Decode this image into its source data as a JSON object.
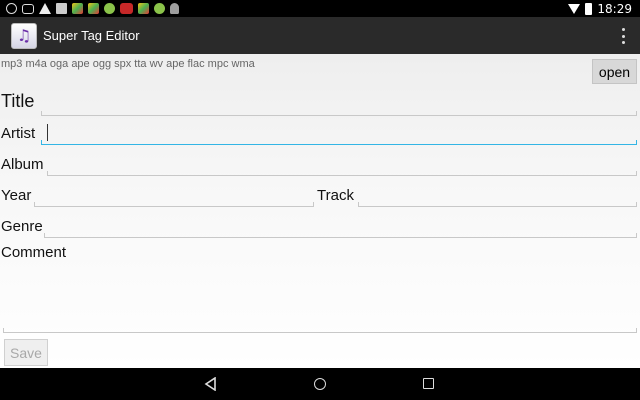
{
  "status_bar": {
    "time": "18:29",
    "icons": [
      "circle-icon",
      "cloud-icon",
      "warning-icon",
      "image-icon",
      "app-icon",
      "app-icon",
      "app-icon",
      "game-icon",
      "app-icon",
      "app-icon",
      "android-icon"
    ],
    "right_icons": [
      "wifi-icon",
      "battery-icon"
    ]
  },
  "action_bar": {
    "app_icon": "music-note-icon",
    "title": "Super Tag Editor",
    "menu_icon": "overflow-menu-icon"
  },
  "formats_text": "mp3 m4a oga ape ogg spx tta wv ape flac mpc wma",
  "open_button": "open",
  "fields": {
    "title": {
      "label": "Title",
      "value": ""
    },
    "artist": {
      "label": "Artist",
      "value": "",
      "focused": true
    },
    "album": {
      "label": "Album",
      "value": ""
    },
    "year": {
      "label": "Year",
      "value": ""
    },
    "track": {
      "label": "Track",
      "value": ""
    },
    "genre": {
      "label": "Genre",
      "value": ""
    },
    "comment": {
      "label": "Comment",
      "value": ""
    }
  },
  "save_button": {
    "label": "Save",
    "enabled": false
  },
  "nav_bar": [
    "back-icon",
    "home-icon",
    "recents-icon"
  ],
  "colors": {
    "status_bar": "#000000",
    "action_bar": "#2a2a2a",
    "focus_accent": "#33b5e5",
    "disabled_text": "#a8a8a8"
  }
}
